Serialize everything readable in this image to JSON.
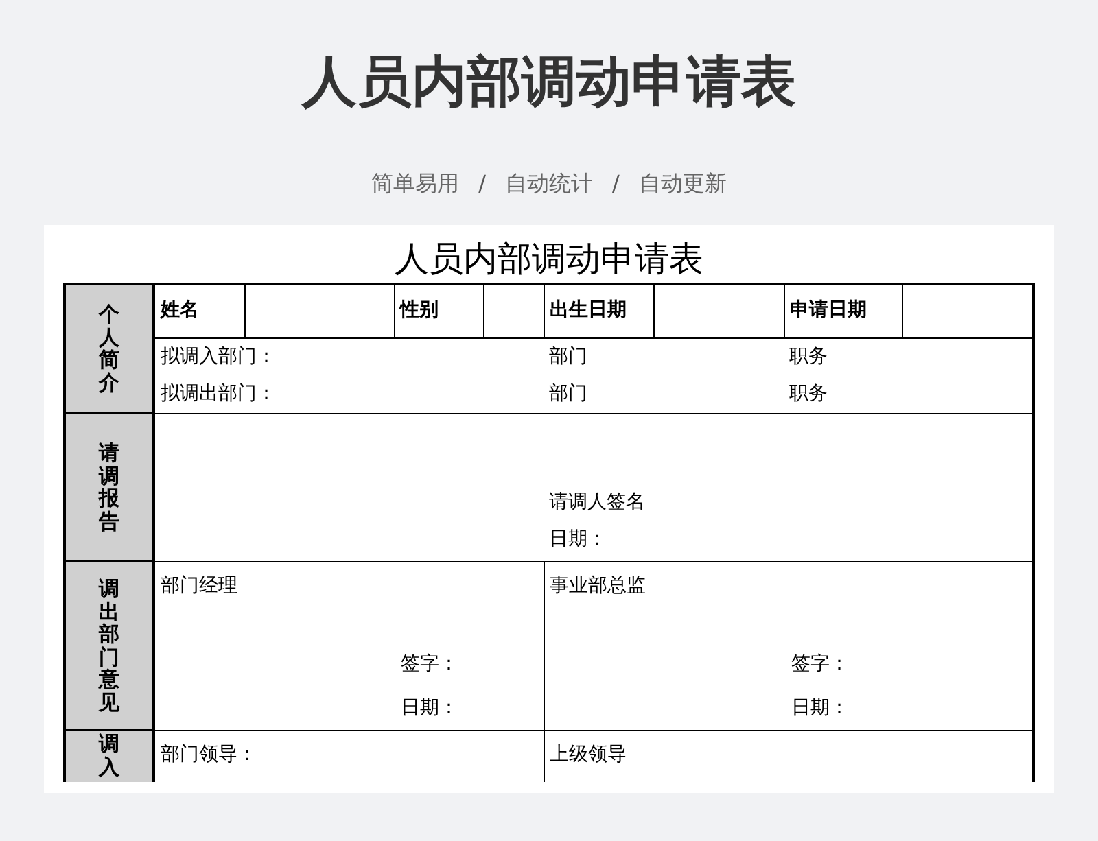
{
  "header": {
    "title": "人员内部调动申请表",
    "tagline": [
      {
        "kind": "label",
        "text": "简单易用"
      },
      {
        "kind": "separator",
        "text": "/"
      },
      {
        "kind": "label",
        "text": "自动统计"
      },
      {
        "kind": "separator",
        "text": "/"
      },
      {
        "kind": "label",
        "text": "自动更新"
      }
    ]
  },
  "sheet": {
    "title": "人员内部调动申请表",
    "personal": {
      "label": "个人简介",
      "fields": [
        "姓名",
        "性别",
        "出生日期",
        "申请日期"
      ],
      "transfer_rows": [
        [
          "拟调入部门：",
          "部门",
          "职务"
        ],
        [
          "拟调出部门：",
          "部门",
          "职务"
        ]
      ]
    },
    "report": {
      "label": "请调报告",
      "signature": "请调人签名",
      "date": "日期："
    },
    "out_opinion": {
      "label": "调出部门意见",
      "panels": [
        {
          "title": "部门经理",
          "sign": "签字：",
          "date": "日期："
        },
        {
          "title": "事业部总监",
          "sign": "签字：",
          "date": "日期："
        }
      ]
    },
    "in_opinion": {
      "label": "调入",
      "panels": [
        {
          "title": "部门领导："
        },
        {
          "title": "上级领导"
        }
      ]
    }
  }
}
